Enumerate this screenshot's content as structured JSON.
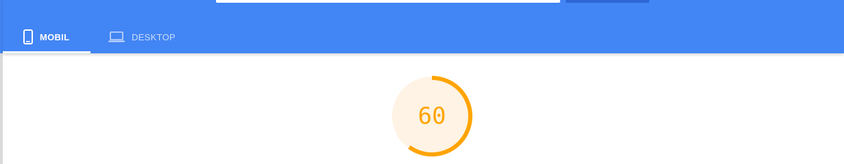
{
  "tabs": [
    {
      "label": "MOBIL",
      "icon": "smartphone-icon",
      "active": true
    },
    {
      "label": "DESKTOP",
      "icon": "laptop-icon",
      "active": false
    }
  ],
  "score": {
    "value": "60",
    "fraction": 0.6,
    "color": "#ffa400",
    "background": "#fef3e4"
  },
  "colors": {
    "header": "#4285f4",
    "button": "#2e66d6"
  }
}
